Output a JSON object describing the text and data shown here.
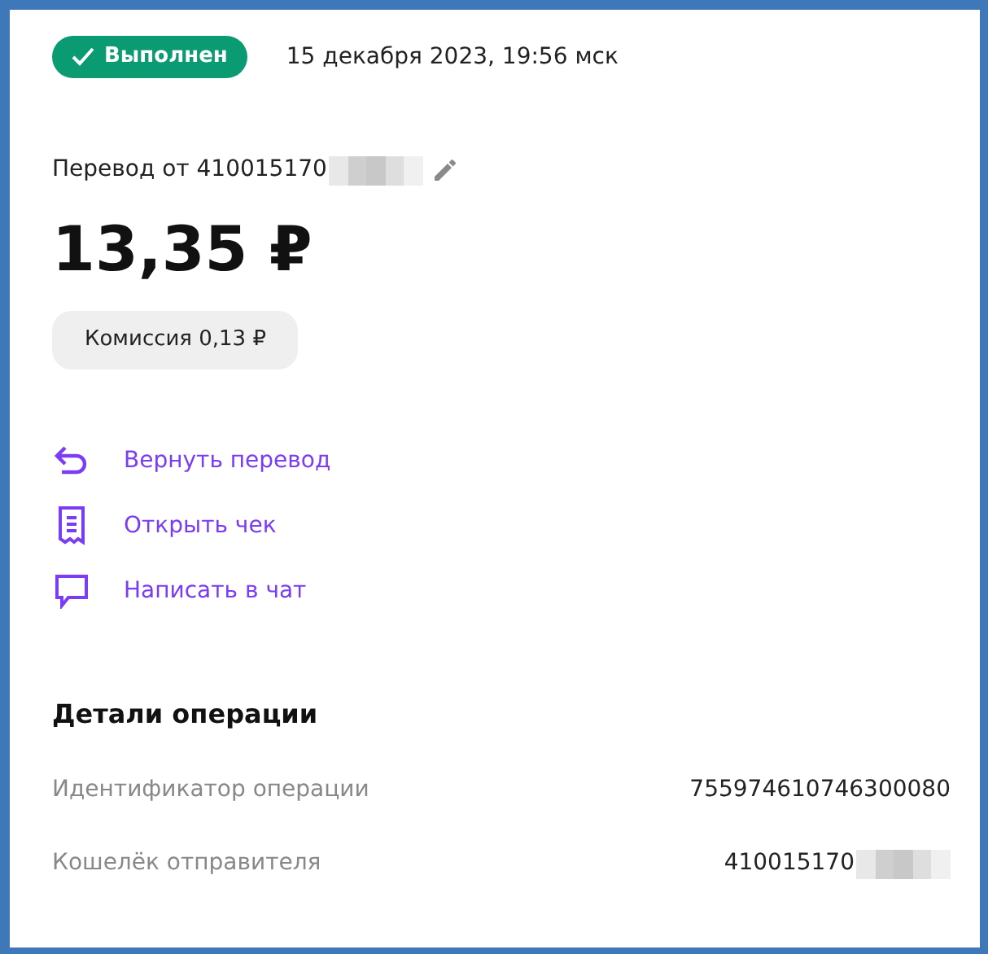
{
  "status": {
    "label": "Выполнен"
  },
  "date": "15 декабря 2023, 19:56 мск",
  "transfer": {
    "label": "Перевод от 410015170"
  },
  "amount": "13,35 ₽",
  "commission": "Комиссия 0,13 ₽",
  "actions": [
    {
      "kind": "return",
      "label": "Вернуть перевод"
    },
    {
      "kind": "receipt",
      "label": "Открыть чек"
    },
    {
      "kind": "chat",
      "label": "Написать в чат"
    }
  ],
  "details": {
    "title": "Детали операции",
    "rows": [
      {
        "label": "Идентификатор операции",
        "value": "755974610746300080",
        "redacted": false
      },
      {
        "label": "Кошелёк отправителя",
        "value": "410015170",
        "redacted": true
      }
    ]
  }
}
